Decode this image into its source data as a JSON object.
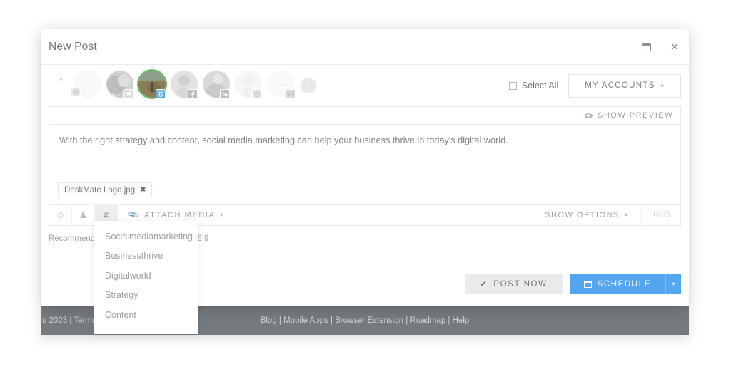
{
  "window": {
    "title": "New Post",
    "restore_icon": "restore-window-icon",
    "close_icon": "close-icon"
  },
  "accounts": {
    "collapse_caret": "^",
    "add_account_label": "+",
    "select_all_label": "Select All",
    "my_accounts_label": "MY ACCOUNTS",
    "my_accounts_caret": "▾",
    "items": [
      {
        "platform": "instagram",
        "selected": false,
        "dim": true,
        "badge": "instagram-badge"
      },
      {
        "platform": "twitter",
        "selected": false,
        "dim": false,
        "badge": "twitter-badge"
      },
      {
        "platform": "instagram",
        "selected": true,
        "dim": false,
        "badge": "instagram-badge"
      },
      {
        "platform": "facebook",
        "selected": false,
        "dim": false,
        "badge": "facebook-badge"
      },
      {
        "platform": "linkedin",
        "selected": false,
        "dim": false,
        "badge": "linkedin-badge"
      },
      {
        "platform": "pinterest",
        "selected": false,
        "dim": true,
        "badge": "pinterest-badge"
      },
      {
        "platform": "google",
        "selected": false,
        "dim": true,
        "badge": "google-badge"
      }
    ]
  },
  "composer": {
    "preview_label": "SHOW PREVIEW",
    "preview_icon": "eye-icon",
    "text": "With the right strategy and content, social media marketing can help your business thrive in today's digital world.",
    "attachment": {
      "filename": "DeskMate Logo.jpg",
      "remove_label": "✖"
    },
    "toolbar": {
      "emoji_icon": "☺",
      "ai_icon": "♟",
      "hashtag_icon": "#",
      "attach_media_label": "ATTACH MEDIA",
      "attach_media_caret": "▾",
      "attach_media_icon": "paperclip-icon",
      "show_options_label": "SHOW OPTIONS",
      "show_options_caret": "▾",
      "character_count": "1885"
    }
  },
  "recommendation": {
    "text": "Recommended",
    "ratio": "16:9"
  },
  "hashtag_dropdown": {
    "items": [
      "Socialmediamarketing",
      "Businessthrive",
      "Digitalworld",
      "Strategy",
      "Content"
    ]
  },
  "actions": {
    "post_now_label": "POST NOW",
    "post_now_icon": "✔",
    "schedule_label": "SCHEDULE",
    "schedule_icon": "calendar-icon",
    "schedule_caret": "▾"
  },
  "footer": {
    "left_text": "u 2023 | Terms",
    "center_text": "Blog | Mobile Apps | Browser Extension | Roadmap | Help"
  },
  "colors": {
    "accent_blue": "#55a6f0",
    "footer_gray": "#757a7e",
    "selected_ring": "#6abf69"
  }
}
